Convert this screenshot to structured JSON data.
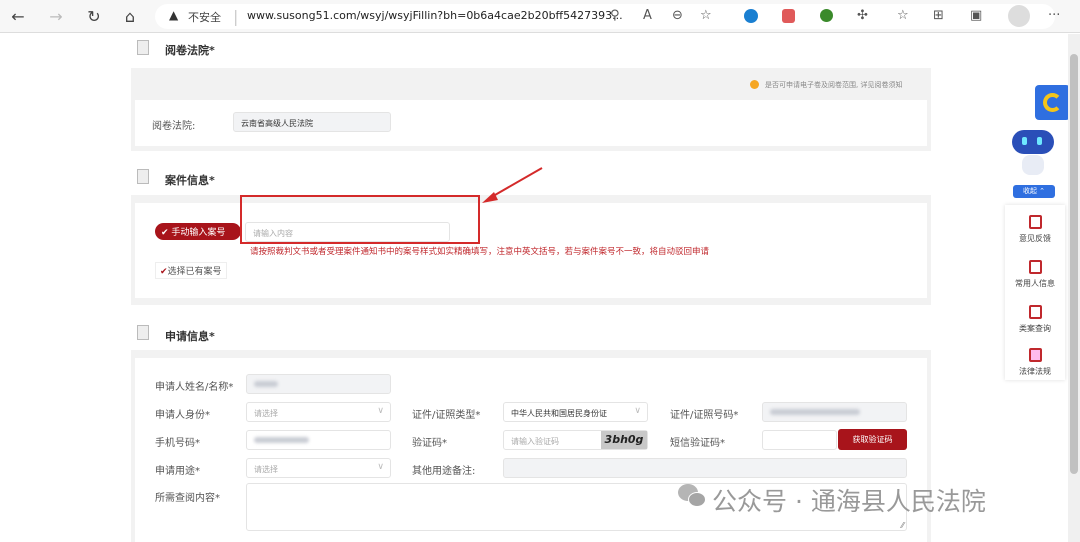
{
  "browser": {
    "security_label": "不安全",
    "url": "www.susong51.com/wsyj/wsyjFillin?bh=0b6a4cae2b20bff5427393..."
  },
  "sections": {
    "court": {
      "title": "阅卷法院*",
      "notice": "是否可申请电子卷及阅卷范围, 详见阅卷须知",
      "label": "阅卷法院:",
      "value": "云南省高级人民法院"
    },
    "case": {
      "title": "案件信息*",
      "option_manual": "手动输入案号",
      "option_existing": "选择已有案号",
      "input_placeholder": "请输入内容",
      "hint": "请按照裁判文书或者受理案件通知书中的案号样式如实精确填写，注意中英文括号，若与案件案号不一致，将自动驳回申请"
    },
    "apply": {
      "title": "申请信息*",
      "name_label": "申请人姓名/名称*",
      "identity_label": "申请人身份*",
      "identity_placeholder": "请选择",
      "id_type_label": "证件/证照类型*",
      "id_type_value": "中华人民共和国居民身份证",
      "id_no_label": "证件/证照号码*",
      "phone_label": "手机号码*",
      "captcha_label": "验证码*",
      "captcha_placeholder": "请输入验证码",
      "captcha_image_text": "3bh0g",
      "sms_label": "短信验证码*",
      "sms_button": "获取验证码",
      "purpose_label": "申请用途*",
      "purpose_placeholder": "请选择",
      "purpose_note_label": "其他用途备注:",
      "content_label": "所需查阅内容*"
    }
  },
  "sidebar": {
    "collapse": "收起",
    "items": [
      "意见反馈",
      "常用人信息",
      "类案查询",
      "法律法规"
    ]
  },
  "watermark": "公众号 · 通海县人民法院",
  "colors": {
    "accent": "#a8141b",
    "blue": "#2f6fe0"
  }
}
